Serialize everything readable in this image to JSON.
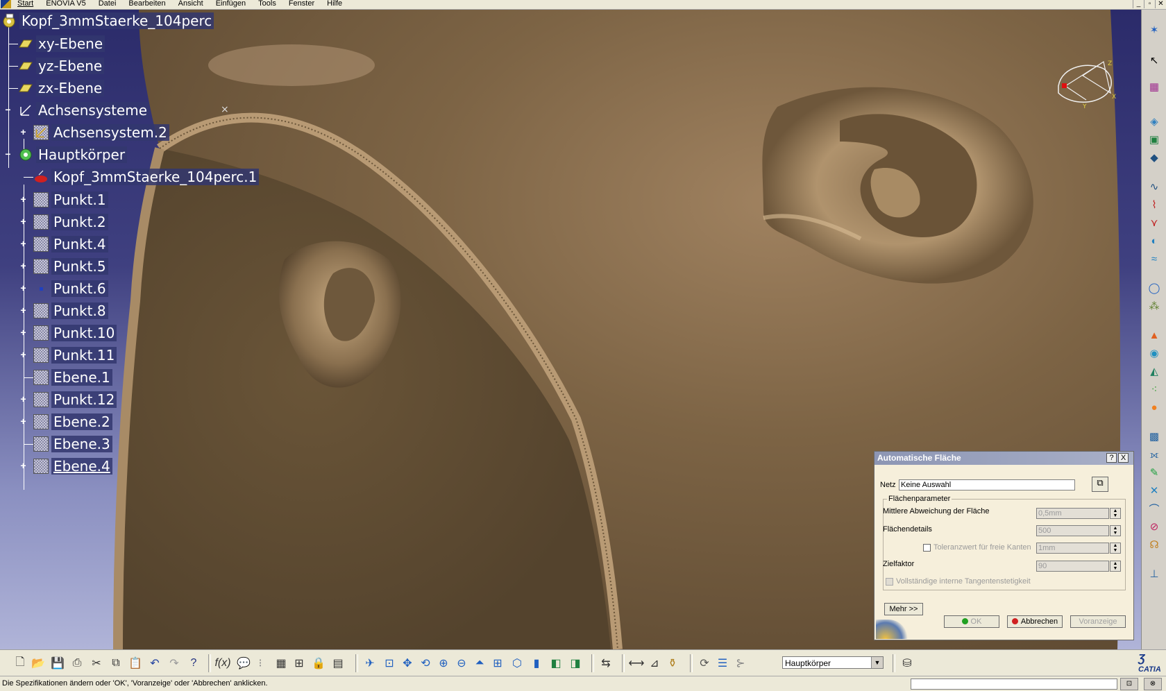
{
  "menu": {
    "items": [
      "Start",
      "ENOVIA V5",
      "Datei",
      "Bearbeiten",
      "Ansicht",
      "Einfügen",
      "Tools",
      "Fenster",
      "Hilfe"
    ]
  },
  "tree": {
    "root": "Kopf_3mmStaerke_104perc",
    "nodes": [
      {
        "label": "xy-Ebene",
        "icon": "plane-icon"
      },
      {
        "label": "yz-Ebene",
        "icon": "plane-icon"
      },
      {
        "label": "zx-Ebene",
        "icon": "plane-icon"
      },
      {
        "label": "Achsensysteme",
        "icon": "axis-system-icon"
      },
      {
        "label": "Achsensystem.2",
        "icon": "axis-system-icon"
      },
      {
        "label": "Hauptkörper",
        "icon": "gear-icon"
      },
      {
        "label": "Kopf_3mmStaerke_104perc.1",
        "icon": "mesh-icon"
      },
      {
        "label": "Punkt.1",
        "icon": "point-icon"
      },
      {
        "label": "Punkt.2",
        "icon": "point-icon"
      },
      {
        "label": "Punkt.4",
        "icon": "point-icon"
      },
      {
        "label": "Punkt.5",
        "icon": "point-icon"
      },
      {
        "label": "Punkt.6",
        "icon": "point-icon"
      },
      {
        "label": "Punkt.8",
        "icon": "point-icon"
      },
      {
        "label": "Punkt.10",
        "icon": "point-icon"
      },
      {
        "label": "Punkt.11",
        "icon": "point-icon"
      },
      {
        "label": "Ebene.1",
        "icon": "plane-icon"
      },
      {
        "label": "Punkt.12",
        "icon": "point-icon"
      },
      {
        "label": "Ebene.2",
        "icon": "plane-icon"
      },
      {
        "label": "Ebene.3",
        "icon": "plane-icon"
      },
      {
        "label": "Ebene.4",
        "icon": "plane-icon"
      }
    ]
  },
  "compass": {
    "x": "X",
    "y": "Y",
    "z": "Z"
  },
  "dialog": {
    "title": "Automatische Fläche",
    "help": "?",
    "close": "X",
    "netz_label": "Netz",
    "netz_value": "Keine Auswahl",
    "group_label": "Flächenparameter",
    "deviation_label": "Mittlere Abweichung der Fläche",
    "deviation_value": "0,5mm",
    "details_label": "Flächendetails",
    "details_value": "500",
    "tolerance_label": "Toleranzwert für freie Kanten",
    "tolerance_value": "1mm",
    "target_label": "Zielfaktor",
    "target_value": "90",
    "tangent_label": "Vollständige interne Tangentenstetigkeit",
    "more_button": "Mehr >>",
    "ok_button": "OK",
    "cancel_button": "Abbrechen",
    "preview_button": "Voranzeige"
  },
  "toolbar": {
    "body_select": "Hauptkörper",
    "catia_logo": "CATIA"
  },
  "status": {
    "message": "Die Spezifikationen ändern oder 'OK', 'Voranzeige' oder 'Abbrechen' anklicken."
  }
}
